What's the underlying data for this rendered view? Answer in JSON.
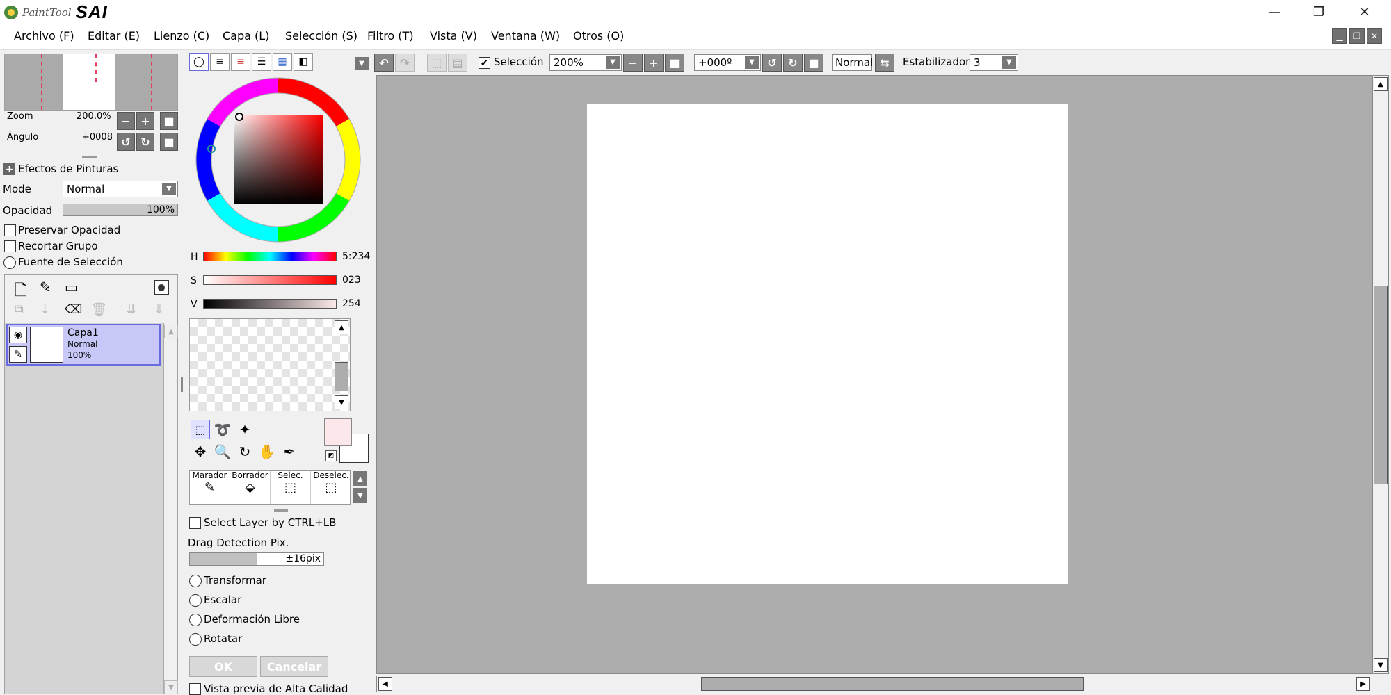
{
  "app": {
    "logo_small": "PaintTool",
    "logo_big": "SAI"
  },
  "window_controls": {
    "minimize": "—",
    "restore": "❐",
    "close": "✕"
  },
  "menu": [
    "Archivo (F)",
    "Editar (E)",
    "Lienzo (C)",
    "Capa (L)",
    "Selección (S)",
    "Filtro (T)",
    "Vista (V)",
    "Ventana (W)",
    "Otros (O)"
  ],
  "navigator": {
    "zoom_label": "Zoom",
    "zoom_value": "200.0%",
    "angle_label": "Ángulo",
    "angle_value": "+0008"
  },
  "layer_props": {
    "effects_label": "Efectos de Pinturas",
    "mode_label": "Mode",
    "mode_value": "Normal",
    "opacity_label": "Opacidad",
    "opacity_value": "100%",
    "preserve_opacity": "Preservar Opacidad",
    "clip_group": "Recortar Grupo",
    "selection_source": "Fuente de Selección"
  },
  "layers": [
    {
      "name": "Capa1",
      "mode": "Normal",
      "opacity": "100%"
    }
  ],
  "color": {
    "h_label": "H",
    "h_value": "5:234",
    "s_label": "S",
    "s_value": "023",
    "v_label": "V",
    "v_value": "254",
    "fg_color": "#fce8ea",
    "bg_color": "#ffffff"
  },
  "brushes": [
    "Marador",
    "Borrador",
    "Selec.",
    "Deselec."
  ],
  "tool_options": {
    "select_layer": "Select Layer by CTRL+LB",
    "drag_detection_label": "Drag Detection Pix.",
    "drag_detection_value": "±16pix",
    "transform_options": [
      "Transformar",
      "Escalar",
      "Deformación Libre",
      "Rotatar"
    ],
    "ok": "OK",
    "cancel": "Cancelar",
    "hq_preview": "Vista previa de Alta Calidad"
  },
  "toolbar": {
    "selection_label": "Selección",
    "zoom_value": "200%",
    "angle_value": "+000º",
    "blend_value": "Normal",
    "stabilizer_label": "Estabilizador",
    "stabilizer_value": "3"
  },
  "accent": "#6a6ae0"
}
